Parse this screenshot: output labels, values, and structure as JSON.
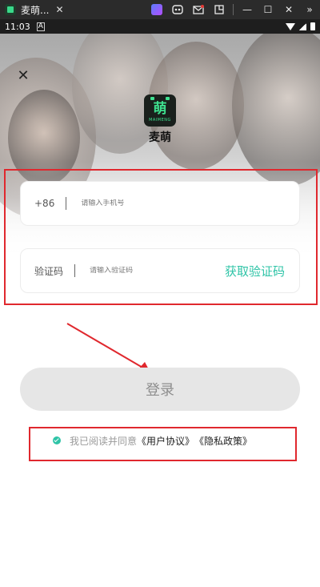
{
  "window": {
    "title": "麦萌...",
    "tab_close": "✕",
    "controls": {
      "gamepad": "gamepad-icon",
      "controller": "controller-icon",
      "mail": "mail-icon",
      "resize": "resize-icon",
      "minimize": "—",
      "maximize": "☐",
      "close": "✕",
      "more": "»"
    },
    "accent_color": "#e53935"
  },
  "status_bar": {
    "time": "11:03",
    "notification": "A"
  },
  "app": {
    "close_label": "✕",
    "name": "麦萌",
    "logo_glyph": "萌",
    "logo_sub": "MAIMENG"
  },
  "form": {
    "phone_prefix": "+86",
    "phone_placeholder": "请输入手机号",
    "code_label": "验证码",
    "code_placeholder": "请输入验证码",
    "get_code_label": "获取验证码",
    "get_code_color": "#2fc4a7"
  },
  "login_label": "登录",
  "agreement": {
    "text": "我已阅读并同意",
    "user_agreement": "《用户协议》",
    "privacy_policy": "《隐私政策》"
  },
  "annotation_color": "#e0282e"
}
